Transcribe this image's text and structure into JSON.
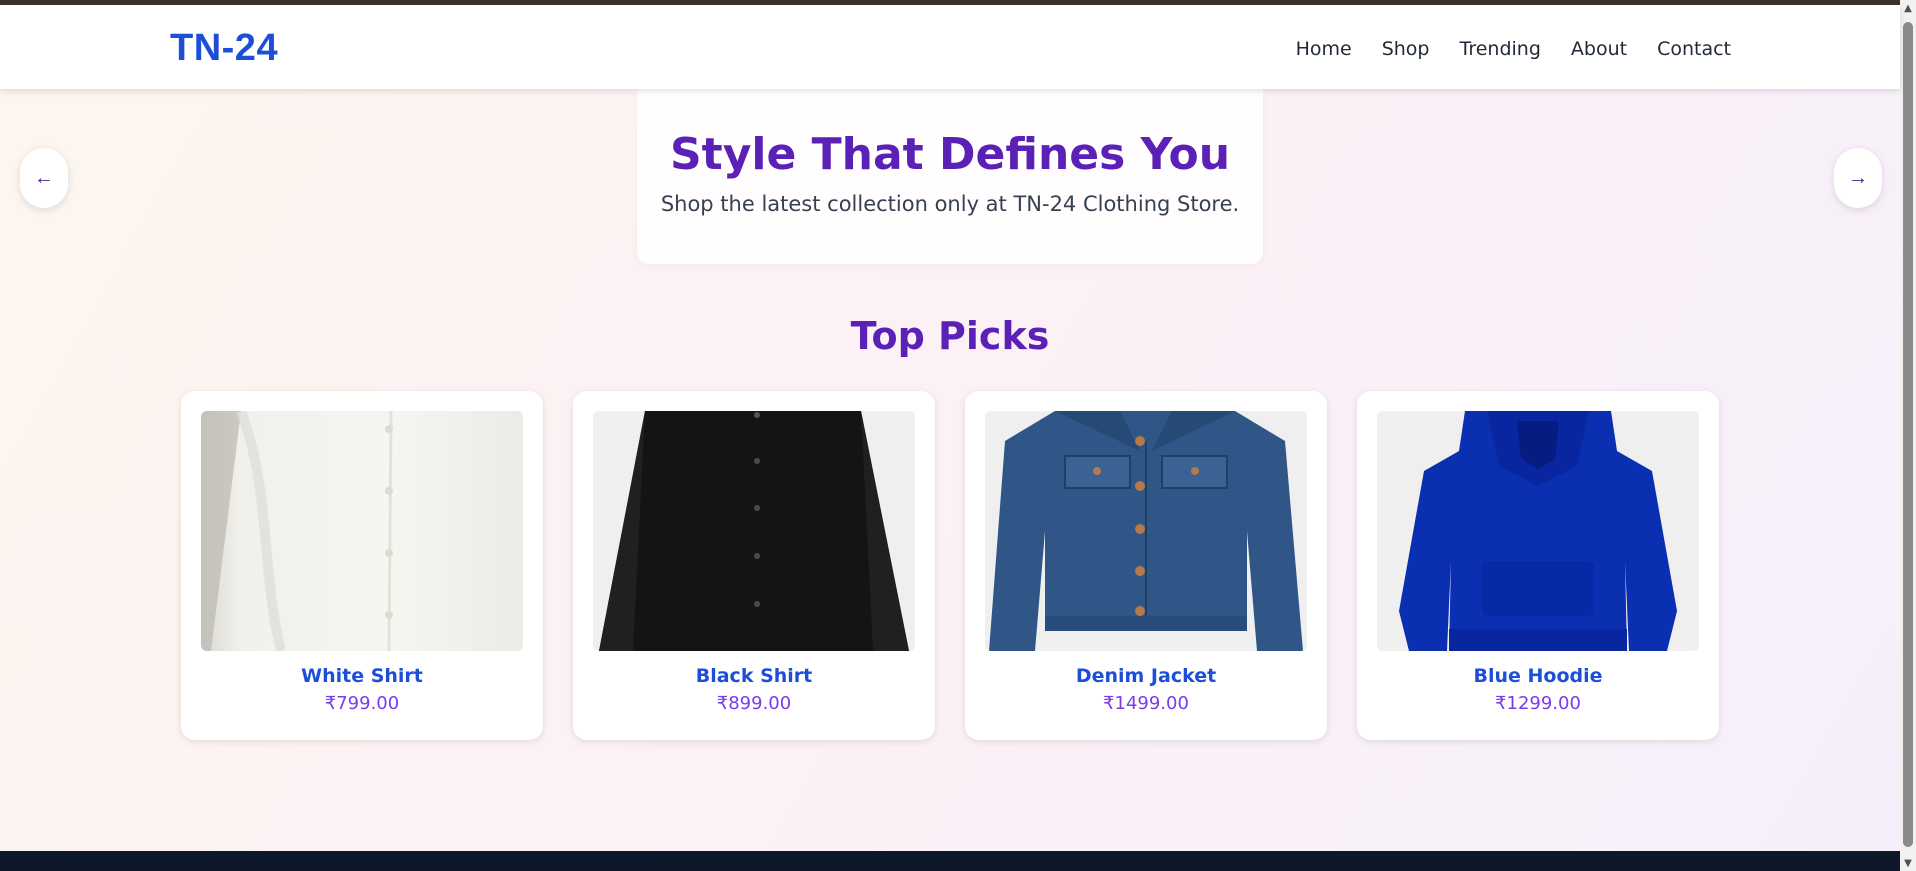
{
  "brand": {
    "logo": "TN-24"
  },
  "nav": {
    "items": [
      {
        "label": "Home"
      },
      {
        "label": "Shop"
      },
      {
        "label": "Trending"
      },
      {
        "label": "About"
      },
      {
        "label": "Contact"
      }
    ]
  },
  "hero": {
    "title": "Style That Defines You",
    "subtitle": "Shop the latest collection only at TN-24 Clothing Store.",
    "prev_arrow": "←",
    "next_arrow": "→"
  },
  "top_picks": {
    "title": "Top Picks",
    "products": [
      {
        "name": "White Shirt",
        "price": "₹799.00",
        "image": "white-shirt"
      },
      {
        "name": "Black Shirt",
        "price": "₹899.00",
        "image": "black-shirt"
      },
      {
        "name": "Denim Jacket",
        "price": "₹1499.00",
        "image": "denim-jacket"
      },
      {
        "name": "Blue Hoodie",
        "price": "₹1299.00",
        "image": "blue-hoodie"
      }
    ]
  },
  "colors": {
    "brand_blue": "#1d4ed8",
    "heading_purple": "#5b21b6",
    "price_purple": "#7c3aed",
    "footer_dark": "#0f172a"
  }
}
